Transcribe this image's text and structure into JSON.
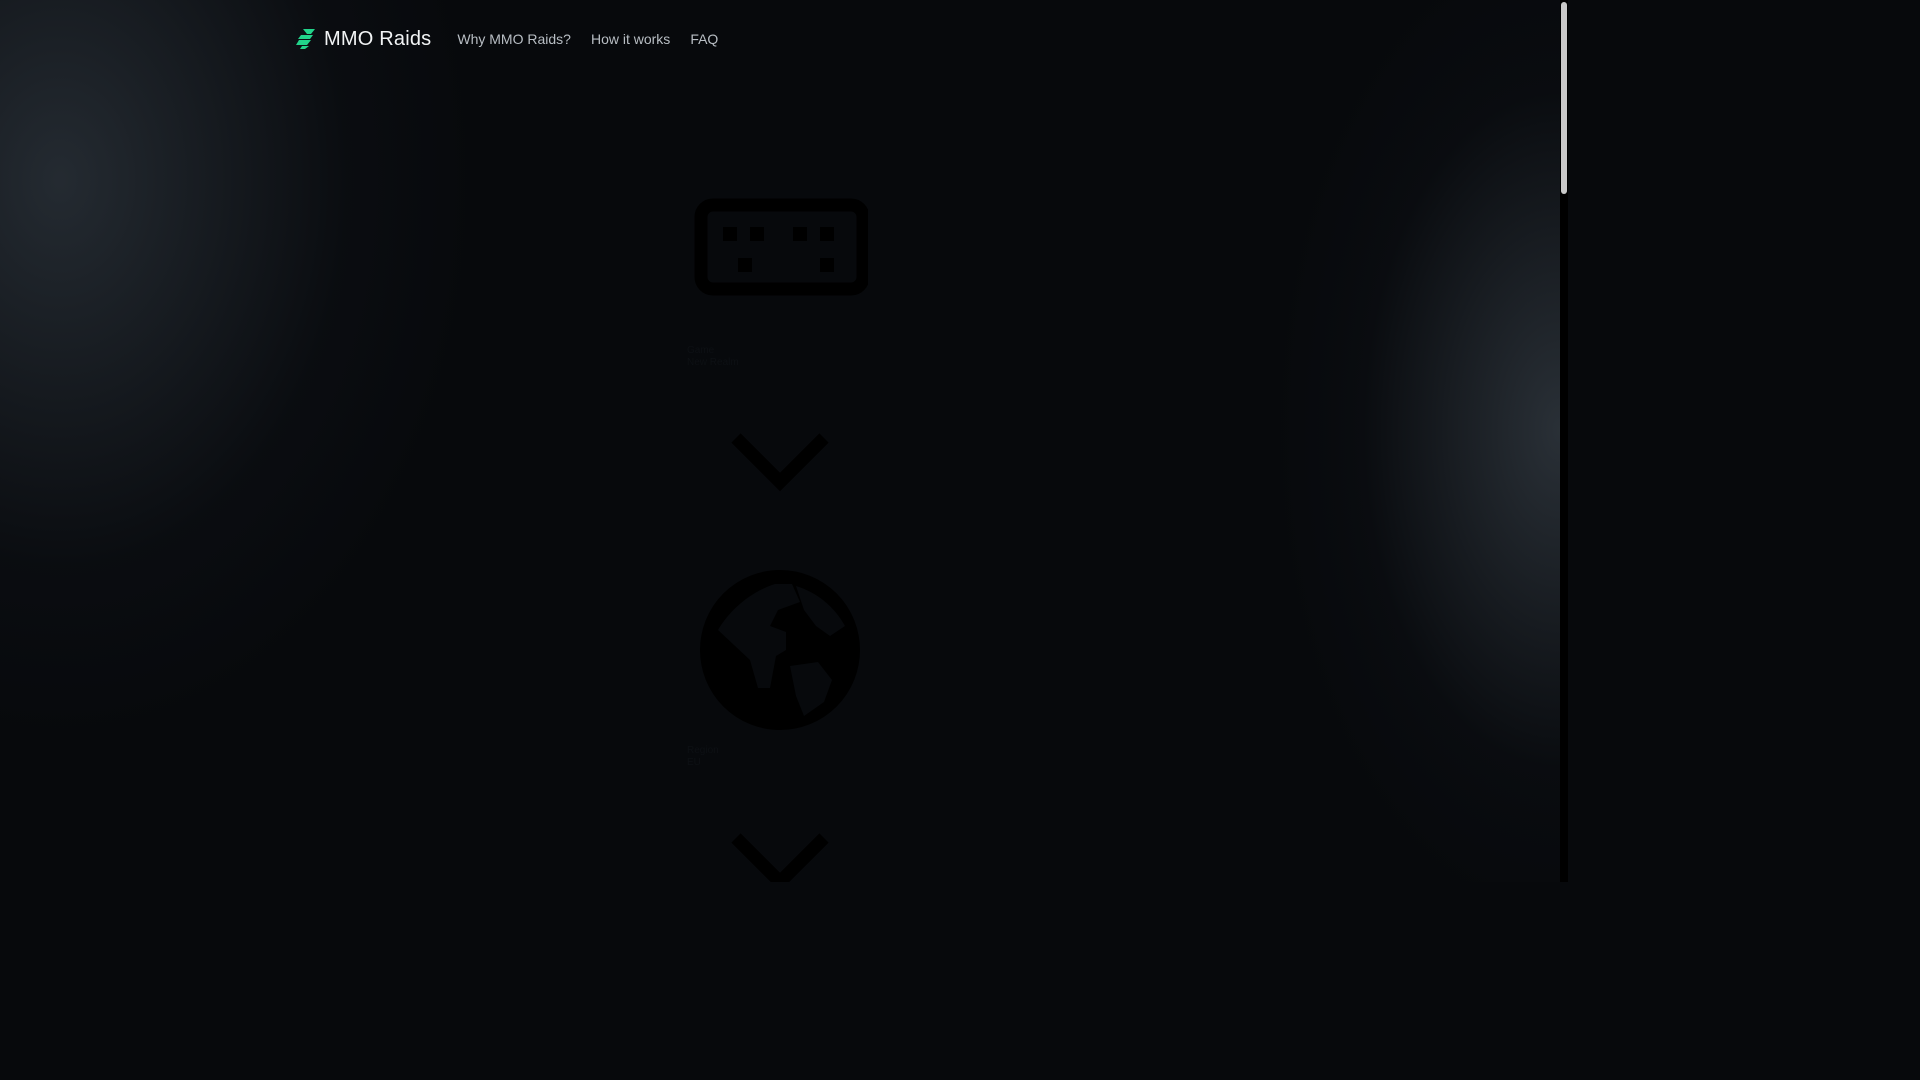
{
  "nav": {
    "brand": "MMO Raids",
    "brand_icon": "lightning-bolt-icon",
    "brand_color": "#22d38a",
    "links": [
      {
        "label": "Why MMO Raids?"
      },
      {
        "label": "How it works"
      },
      {
        "label": "FAQ"
      }
    ]
  },
  "form": {
    "fields": [
      {
        "icon": "game-controller-icon",
        "label": "Game",
        "value": "New Realm"
      },
      {
        "icon": "globe-icon",
        "label": "Region",
        "value": "EU"
      }
    ],
    "chevron_icon": "chevron-down-icon"
  },
  "scrollbar": {
    "visible": true
  }
}
